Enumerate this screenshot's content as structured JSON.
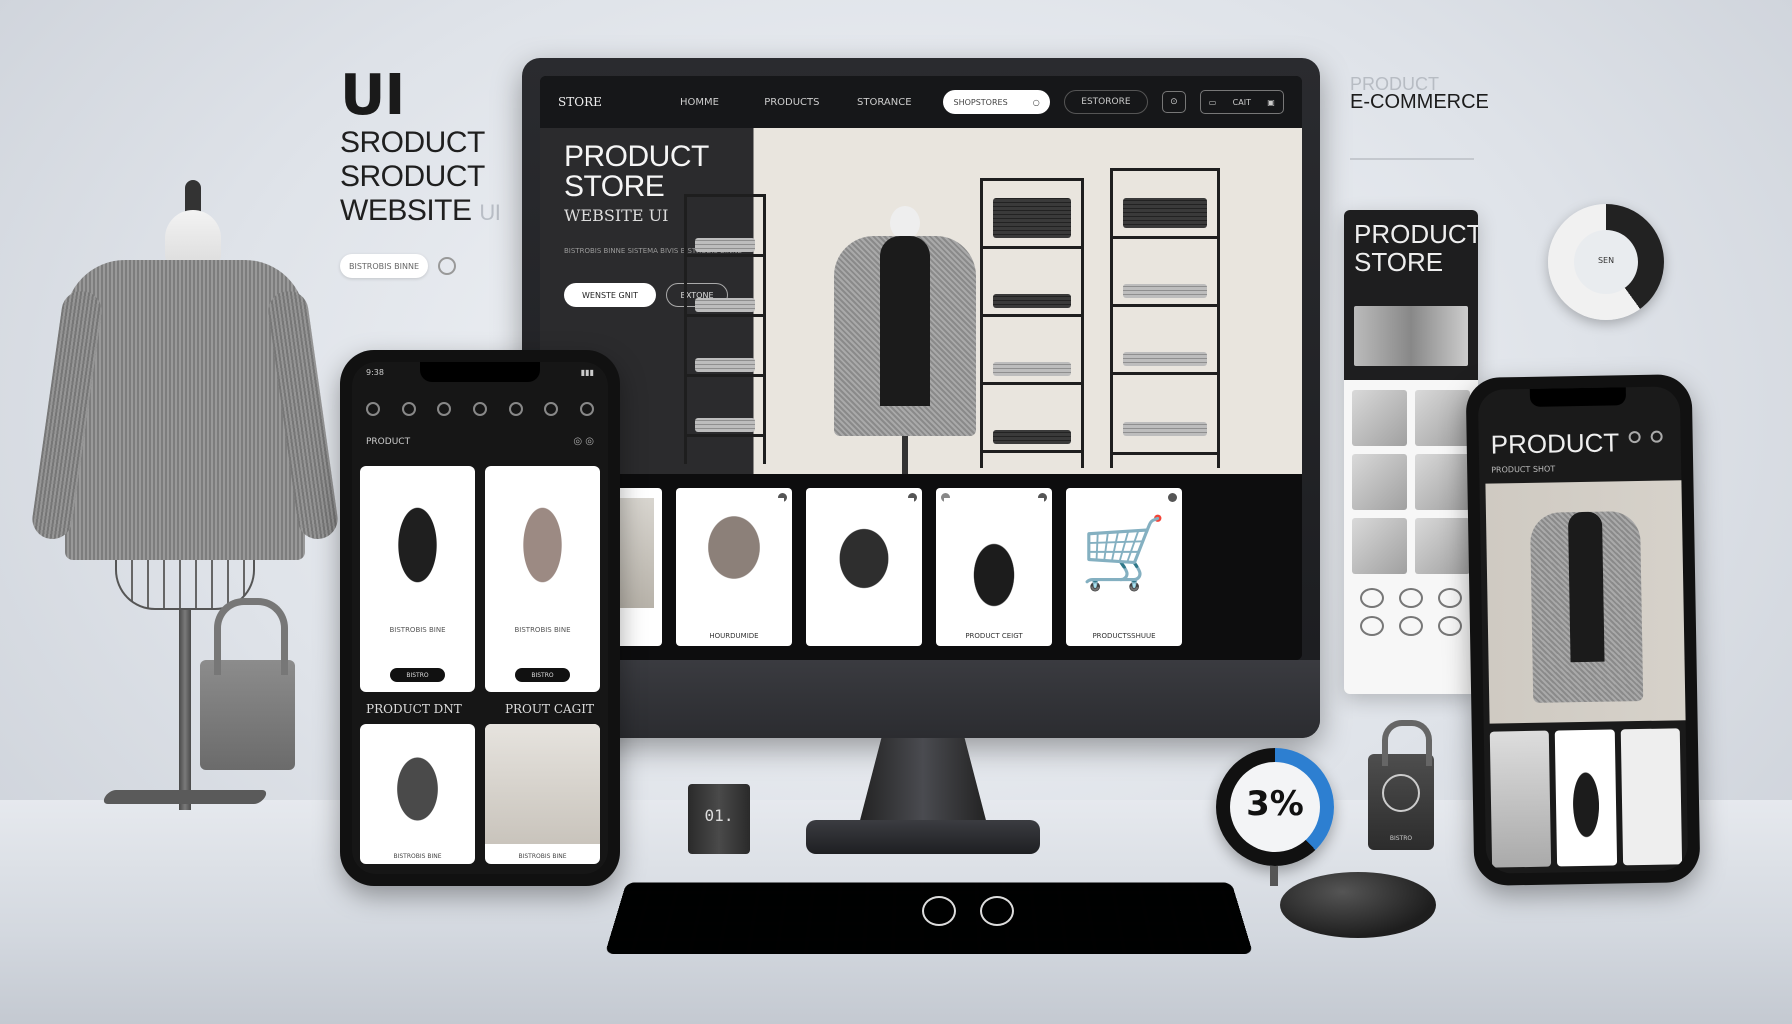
{
  "hero_left": {
    "ui": "UI",
    "line1": "SRODUCT",
    "line2": "SRODUCT",
    "line3": "WEBSITE",
    "line3_faint": "UI",
    "pill": "BISTROBIS BINNE"
  },
  "right_label": {
    "faint": "PRODUCT",
    "main": "E-COMMERCE"
  },
  "monitor": {
    "nav": {
      "brand": "STORE",
      "links": [
        "HOMME",
        "PRODUCTS",
        "STORANCE"
      ],
      "search_placeholder": "SHOPSTORES",
      "account": "ESTORORE",
      "cart": "CAIT"
    },
    "hero": {
      "title": "PRODUCT STORE",
      "subtitle": "WEBSITE UI",
      "description": "BISTROBIS BINNE SISTEMA BIVIS BISTROBIS BINNE",
      "primary_button": "WENSTE GNIT",
      "secondary_button": "BXTONE"
    },
    "cards": [
      {
        "caption": ""
      },
      {
        "caption": "HOURDUMIDE"
      },
      {
        "caption": ""
      },
      {
        "caption": "PRODUCT CEIGT"
      },
      {
        "caption": "PRODUCTSSHUUE"
      }
    ]
  },
  "phone_left": {
    "time": "9:38",
    "label": "PRODUCT",
    "cards": [
      {
        "caption": "BISTROBIS BINE",
        "button": "BISTRO"
      },
      {
        "caption": "BISTROBIS BINE",
        "button": "BISTRO"
      }
    ],
    "section_a": "PRODUCT DNT",
    "section_b": "PROUT CAGIT",
    "cards2": [
      {
        "caption": "BISTROBIS BINE"
      },
      {
        "caption": "BISTROBIS BINE"
      }
    ]
  },
  "tall_panel": {
    "title": "PRODUCT STORE"
  },
  "phone_right": {
    "title": "PRODUCT",
    "sub": "PRODUCT SHOT"
  },
  "donut": {
    "label": "SEN"
  },
  "gauge": {
    "value": "3%"
  },
  "cup": {
    "label": "01."
  },
  "lock": {
    "label": "BISTRO"
  },
  "colors": {
    "accent_blue": "#2d7fd1",
    "dark": "#161719",
    "light": "#f4f6f9"
  }
}
